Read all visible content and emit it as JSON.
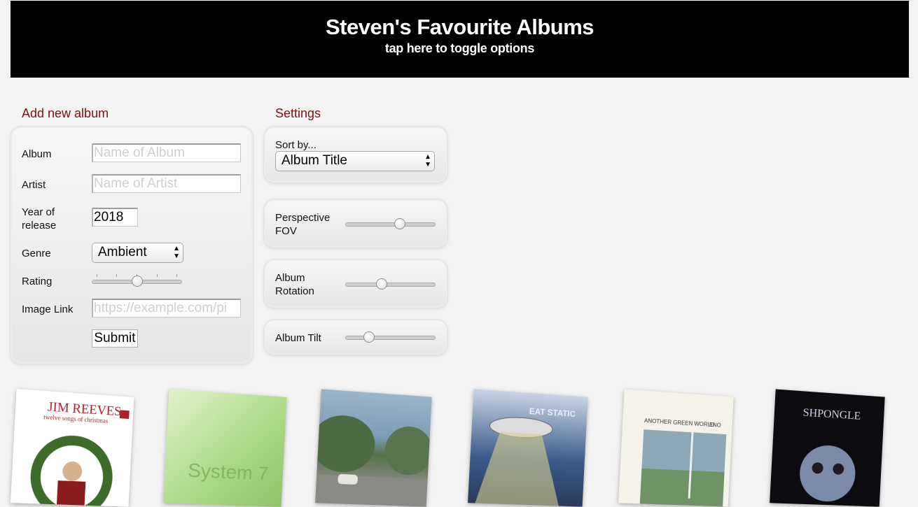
{
  "header": {
    "title": "Steven's Favourite Albums",
    "subtitle": "tap here to toggle options"
  },
  "add_album": {
    "section_title": "Add new album",
    "album_label": "Album",
    "album_placeholder": "Name of Album",
    "artist_label": "Artist",
    "artist_placeholder": "Name of Artist",
    "year_label": "Year of release",
    "year_value": "2018",
    "genre_label": "Genre",
    "genre_value": "Ambient",
    "rating_label": "Rating",
    "rating_value": 0.5,
    "image_label": "Image Link",
    "image_placeholder": "https://example.com/pi",
    "submit_label": "Submit"
  },
  "settings": {
    "section_title": "Settings",
    "sort_label": "Sort by...",
    "sort_value": "Album Title",
    "fov_label": "Perspective FOV",
    "fov_value": 0.62,
    "rotation_label": "Album Rotation",
    "rotation_value": 0.39,
    "tilt_label": "Album Tilt",
    "tilt_value": 0.23
  },
  "albums": [
    {
      "cover_text": "JIM REEVES",
      "cover_subtext": "twelve songs of christmas",
      "colors": {
        "bg": "#ffffff",
        "accent": "#b0202a",
        "wreath": "#3d6b2a"
      }
    },
    {
      "cover_text": "System 7",
      "colors": {
        "bg": "#bfe3a0",
        "accent": "#8fc36a"
      }
    },
    {
      "cover_text": "",
      "colors": {
        "sky": "#7d9bb5",
        "trees": "#55704a",
        "road": "#8a8a84"
      }
    },
    {
      "cover_text": "EAT STATIC",
      "colors": {
        "sky": "#3a5a8a",
        "beam": "#d8d090"
      }
    },
    {
      "cover_text": "ANOTHER GREEN WORLD",
      "cover_subtext": "ENO",
      "colors": {
        "bg": "#f5f2ea",
        "art": "#8fa8b8"
      }
    },
    {
      "cover_text": "SHPONGLE",
      "colors": {
        "bg": "#0c0c10",
        "art": "#7c8ba8"
      }
    }
  ]
}
